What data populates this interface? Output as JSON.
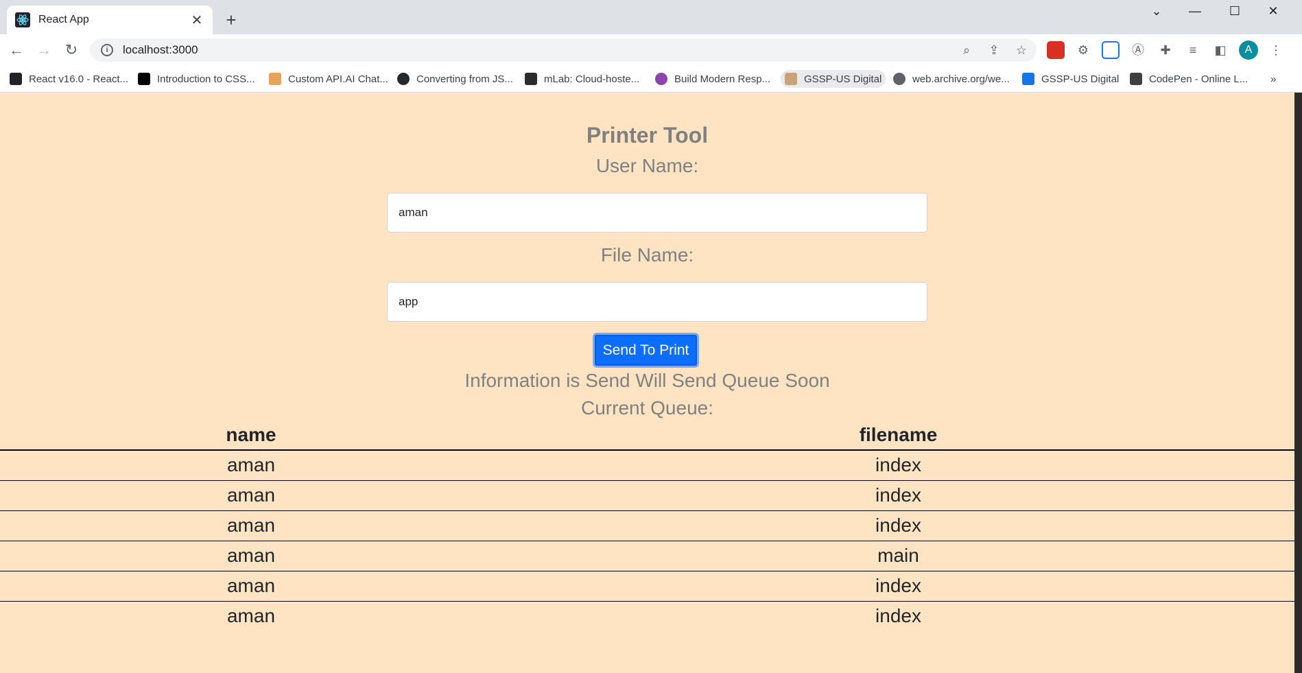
{
  "browser": {
    "tab_title": "React App",
    "url": "localhost:3000",
    "avatar_letter": "A",
    "bookmarks": [
      {
        "label": "React v16.0 - React...",
        "icon": "react-icon",
        "color": "#20232a"
      },
      {
        "label": "Introduction to CSS...",
        "icon": "mdn-icon",
        "color": "#000000"
      },
      {
        "label": "Custom API.AI Chat...",
        "icon": "bot-icon",
        "color": "#e8a25a"
      },
      {
        "label": "Converting from JS...",
        "icon": "github-icon",
        "color": "#24292e"
      },
      {
        "label": "mLab: Cloud-hoste...",
        "icon": "mlab-icon",
        "color": "#2c2c2c"
      },
      {
        "label": "Build Modern Resp...",
        "icon": "info-icon",
        "color": "#8e44ad"
      },
      {
        "label": "GSSP-US Digital",
        "icon": "avatar-icon",
        "color": "#c9a37a"
      },
      {
        "label": "web.archive.org/we...",
        "icon": "globe-icon",
        "color": "#5f6368"
      },
      {
        "label": "GSSP-US Digital",
        "icon": "gssp-icon",
        "color": "#1a73e8"
      },
      {
        "label": "CodePen - Online L...",
        "icon": "codepen-icon",
        "color": "#3c4043"
      }
    ]
  },
  "app": {
    "title": "Printer Tool",
    "user_label": "User Name:",
    "user_value": "aman",
    "file_label": "File Name:",
    "file_value": "app",
    "button_label": "Send To Print",
    "status_text": "Information is Send Will Send Queue Soon",
    "queue_label": "Current Queue:",
    "table": {
      "headers": [
        "name",
        "filename"
      ],
      "rows": [
        [
          "aman",
          "index"
        ],
        [
          "aman",
          "index"
        ],
        [
          "aman",
          "index"
        ],
        [
          "aman",
          "main"
        ],
        [
          "aman",
          "index"
        ],
        [
          "aman",
          "index"
        ]
      ]
    }
  },
  "colors": {
    "page_background": "#ffe4c4",
    "text_gray": "#808080",
    "button_blue": "#0d6efd"
  }
}
